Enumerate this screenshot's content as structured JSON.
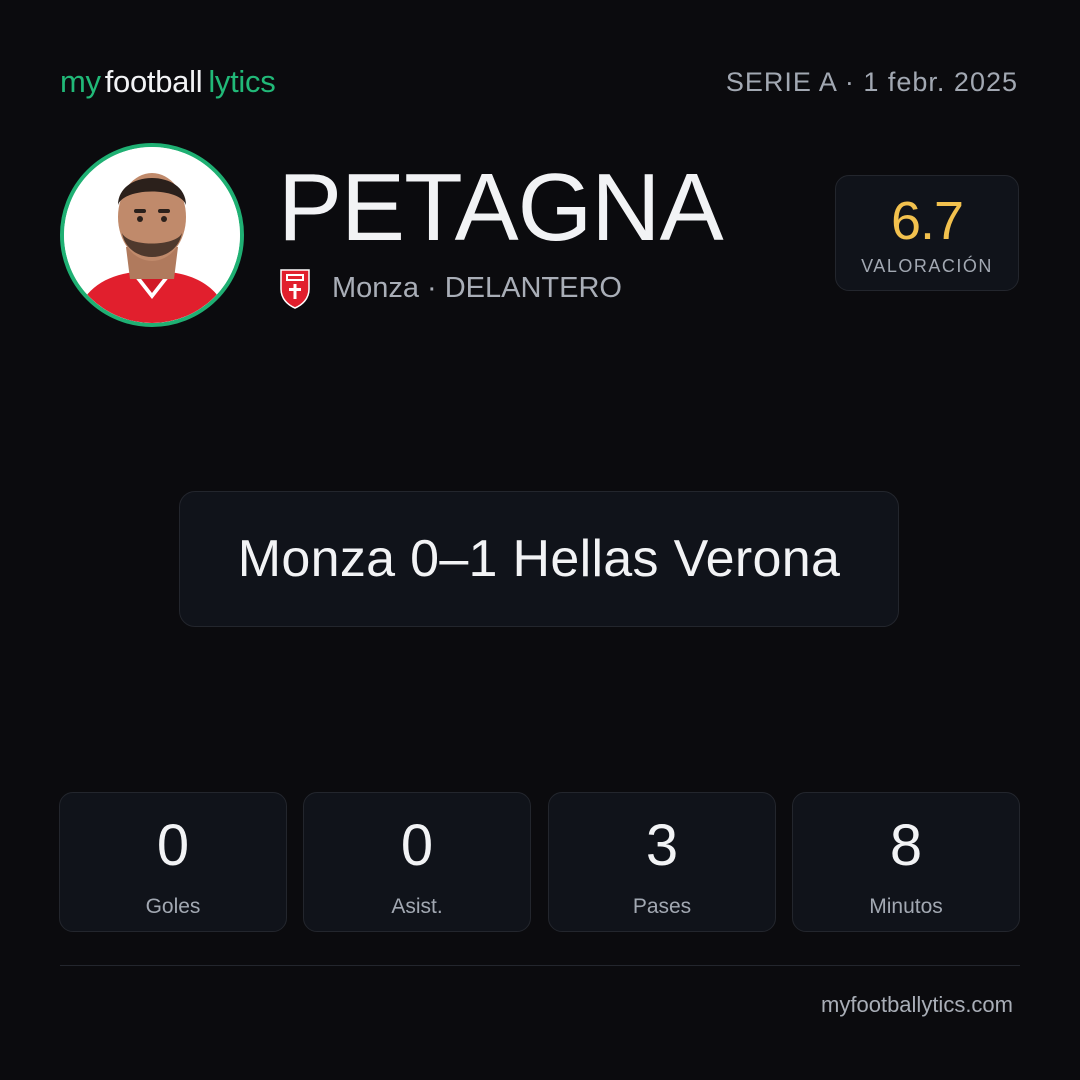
{
  "brand": {
    "part1": "my",
    "part2": "football",
    "part3": "lytics"
  },
  "header": {
    "meta": "SERIE A · 1 febr. 2025"
  },
  "player": {
    "name": "PETAGNA",
    "club": "Monza",
    "separator": "·",
    "position": "DELANTERO",
    "photo_icon": "player-photo",
    "crest_icon": "monza-crest-icon"
  },
  "rating": {
    "value": "6.7",
    "label": "VALORACIÓN"
  },
  "match": {
    "result": "Monza 0–1 Hellas Verona"
  },
  "stats": [
    {
      "value": "0",
      "label": "Goles"
    },
    {
      "value": "0",
      "label": "Asist."
    },
    {
      "value": "3",
      "label": "Pases"
    },
    {
      "value": "8",
      "label": "Minutos"
    }
  ],
  "footer": {
    "url": "myfootballytics.com"
  },
  "colors": {
    "background": "#0b0b0e",
    "accent_green": "#21b978",
    "rating_gold": "#f2c14e",
    "card_bg": "#10131a",
    "muted_text": "#a2a8b2",
    "monza_red": "#e11f2d"
  }
}
